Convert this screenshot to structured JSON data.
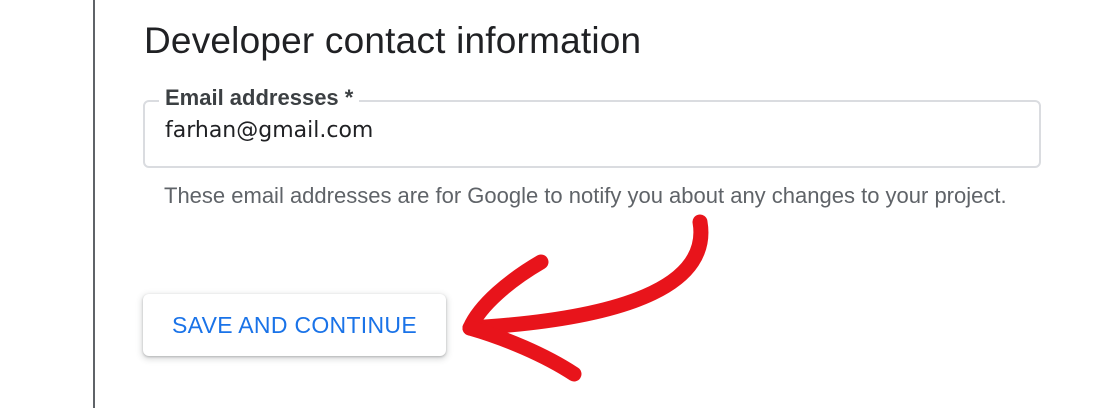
{
  "section": {
    "title": "Developer contact information"
  },
  "email_field": {
    "label": "Email addresses *",
    "value": "farhan@gmail.com"
  },
  "helper_text": "These email addresses are for Google to notify you about any changes to your project.",
  "actions": {
    "save_label": "SAVE AND CONTINUE"
  },
  "annotation": {
    "arrow_color": "#e8141b",
    "icon": "curved-arrow-icon"
  },
  "colors": {
    "accent": "#1a73e8",
    "text_primary": "#202124",
    "text_secondary": "#5f6368",
    "border": "#dadce0"
  }
}
